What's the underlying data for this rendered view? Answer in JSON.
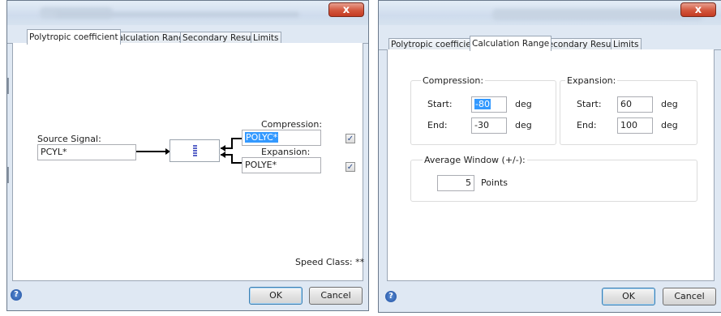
{
  "left_dialog": {
    "close_glyph": "x",
    "tabs": [
      {
        "label": "Polytropic coefficient"
      },
      {
        "label": "Calculation Range"
      },
      {
        "label": "Secondary Results"
      },
      {
        "label": "Limits"
      }
    ],
    "source_signal_label": "Source Signal:",
    "source_signal_value": "PCYL*",
    "compression_label": "Compression:",
    "compression_value": "POLYC*",
    "compression_checked": true,
    "expansion_label": "Expansion:",
    "expansion_value": "POLYE*",
    "expansion_checked": true,
    "speed_class": "Speed Class: **",
    "help_glyph": "?",
    "ok_label": "OK",
    "cancel_label": "Cancel"
  },
  "right_dialog": {
    "close_glyph": "x",
    "tabs": [
      {
        "label": "Polytropic coefficient"
      },
      {
        "label": "Calculation Range"
      },
      {
        "label": "Secondary Results"
      },
      {
        "label": "Limits"
      }
    ],
    "compression": {
      "title": "Compression:",
      "start_label": "Start:",
      "start_value": "-80",
      "end_label": "End:",
      "end_value": "-30",
      "unit": "deg"
    },
    "expansion": {
      "title": "Expansion:",
      "start_label": "Start:",
      "start_value": "60",
      "end_label": "End:",
      "end_value": "100",
      "unit": "deg"
    },
    "average_window": {
      "title": "Average Window (+/-):",
      "value": "5",
      "unit": "Points"
    },
    "help_glyph": "?",
    "ok_label": "OK",
    "cancel_label": "Cancel"
  },
  "colors": {
    "selection": "#3399ff",
    "close_button": "#c43b22",
    "dialog_frame": "#dfe8f3"
  }
}
